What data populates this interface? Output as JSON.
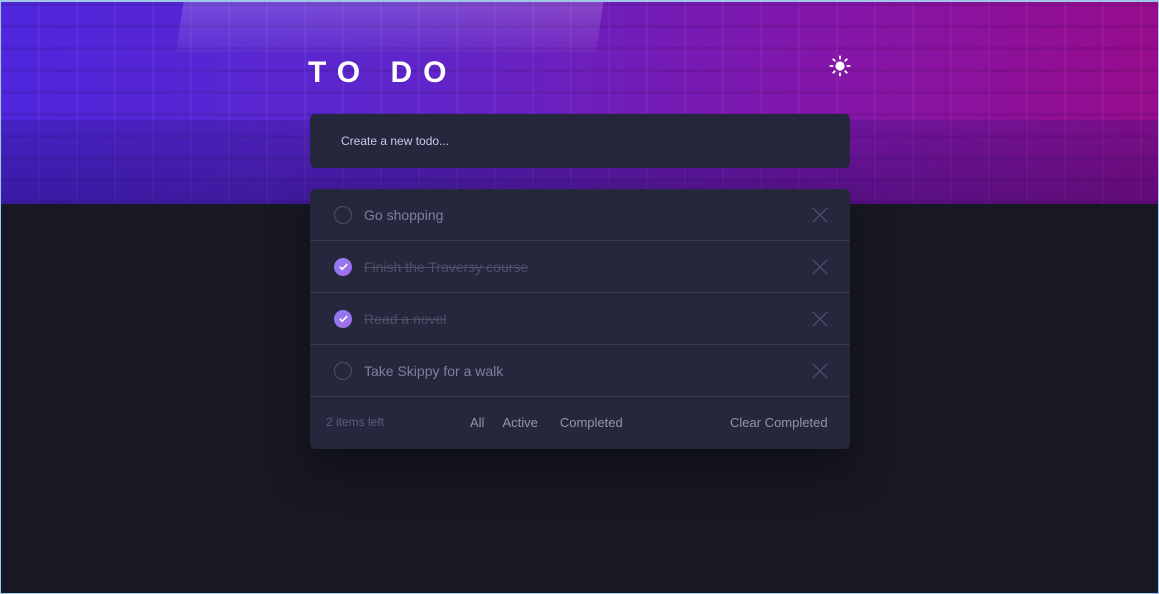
{
  "header": {
    "title": "TO DO",
    "theme_toggle_icon": "sun-icon"
  },
  "new_todo": {
    "placeholder": "Create a new todo..."
  },
  "todos": [
    {
      "text": "Go shopping",
      "completed": false
    },
    {
      "text": "Finish the Traversy course",
      "completed": true
    },
    {
      "text": "Read a novel",
      "completed": true
    },
    {
      "text": "Take Skippy for a walk",
      "completed": false
    }
  ],
  "footer": {
    "items_left": "2 items left",
    "filter_all": "All",
    "filter_active": "Active",
    "filter_completed": "Completed",
    "clear_completed": "Clear Completed"
  },
  "colors": {
    "background": "#181824",
    "card": "#25273c",
    "check_gradient_start": "#8f7cf5",
    "check_gradient_end": "#a36be8",
    "hero_start": "#5528f5",
    "hero_end": "#a00a8c"
  }
}
